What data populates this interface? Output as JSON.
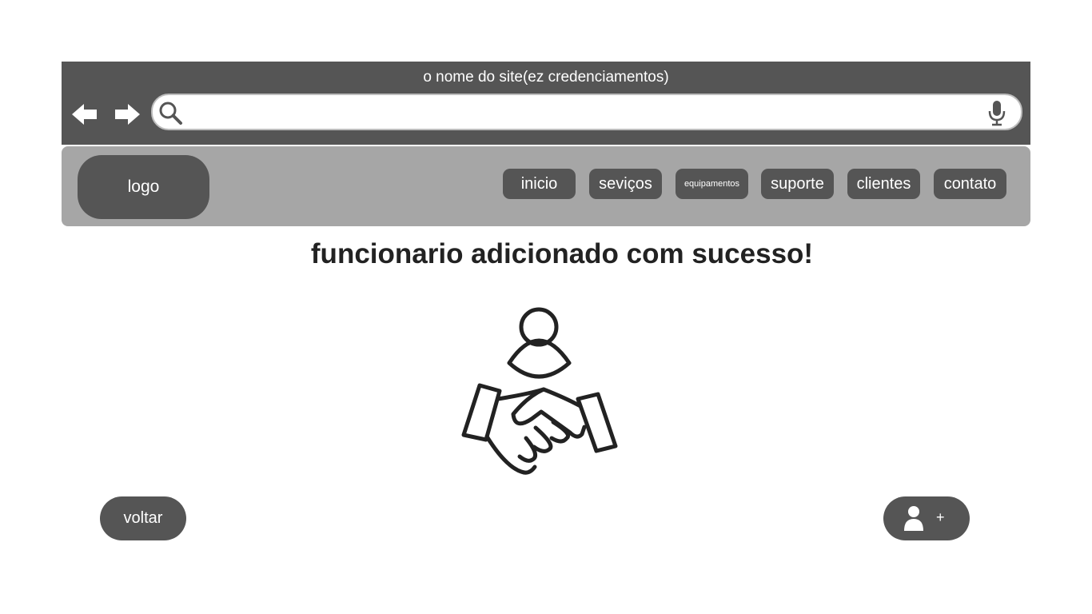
{
  "browser": {
    "title": "o nome do  site(ez credenciamentos)",
    "search_placeholder": "",
    "back_icon": "arrow-left-icon",
    "forward_icon": "arrow-right-icon",
    "search_icon": "search-icon",
    "mic_icon": "microphone-icon"
  },
  "header": {
    "logo_label": "logo",
    "menu": [
      {
        "label": "inicio"
      },
      {
        "label": "seviços"
      },
      {
        "label": "equipamentos"
      },
      {
        "label": "suporte"
      },
      {
        "label": "clientes"
      },
      {
        "label": "contato"
      }
    ]
  },
  "main": {
    "headline": "funcionario adicionado com sucesso!",
    "illustration_icon": "person-handshake-icon"
  },
  "actions": {
    "back_label": "voltar",
    "add_label": "+",
    "add_icon": "user-icon"
  },
  "colors": {
    "dark": "#555555",
    "nav_background": "#a6a6a6",
    "text_dark": "#222222"
  }
}
